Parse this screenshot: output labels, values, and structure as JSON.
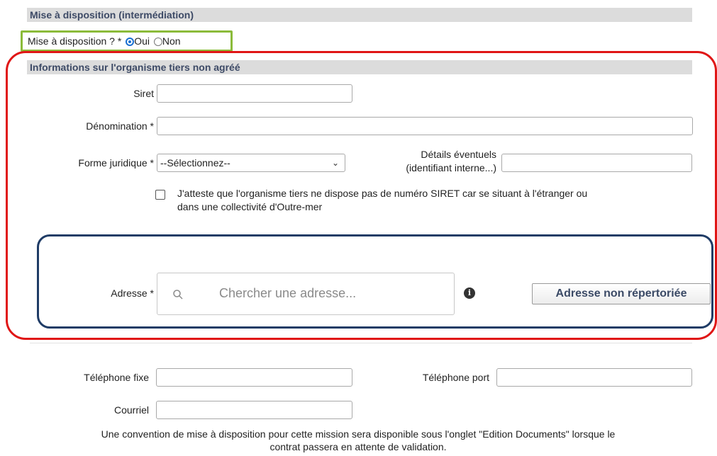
{
  "sections": {
    "mise_a_disposition": "Mise à disposition (intermédiation)",
    "organisme": "Informations sur l'organisme tiers non agréé"
  },
  "mise_question": {
    "label": "Mise à disposition ? *",
    "options": [
      "Oui",
      "Non"
    ],
    "selected": "Oui"
  },
  "form": {
    "siret_label": "Siret",
    "siret_value": "",
    "denomination_label": "Dénomination *",
    "denomination_value": "",
    "forme_label": "Forme juridique *",
    "forme_selected": "--Sélectionnez--",
    "details_label_line1": "Détails éventuels",
    "details_label_line2": "(identifiant interne...)",
    "details_value": "",
    "attest_line1": "J'atteste que l'organisme tiers ne dispose pas de numéro SIRET car se situant à l'étranger ou",
    "attest_line2": "dans une collectivité d'Outre-mer",
    "attest_checked": false,
    "adresse_label": "Adresse *",
    "adresse_placeholder": "Chercher une adresse...",
    "adresse_button": "Adresse non répertoriée",
    "tel_fixe_label": "Téléphone fixe",
    "tel_port_label": "Téléphone port",
    "courriel_label": "Courriel"
  },
  "footer": {
    "line1": "Une convention de mise à disposition pour cette mission sera disponible sous l'onglet \"Edition Documents\" lorsque le",
    "line2": "contrat passera en attente de validation."
  },
  "colors": {
    "highlight_green": "#8bbb3a",
    "highlight_red": "#e01616",
    "highlight_blue": "#1f3c66",
    "header_bg": "#dcdcdc",
    "header_text": "#3d4a66",
    "radio_blue": "#1a6fd1"
  },
  "icons": {
    "search": "search-icon",
    "info": "info-icon",
    "dropdown": "chevron-down-icon"
  }
}
